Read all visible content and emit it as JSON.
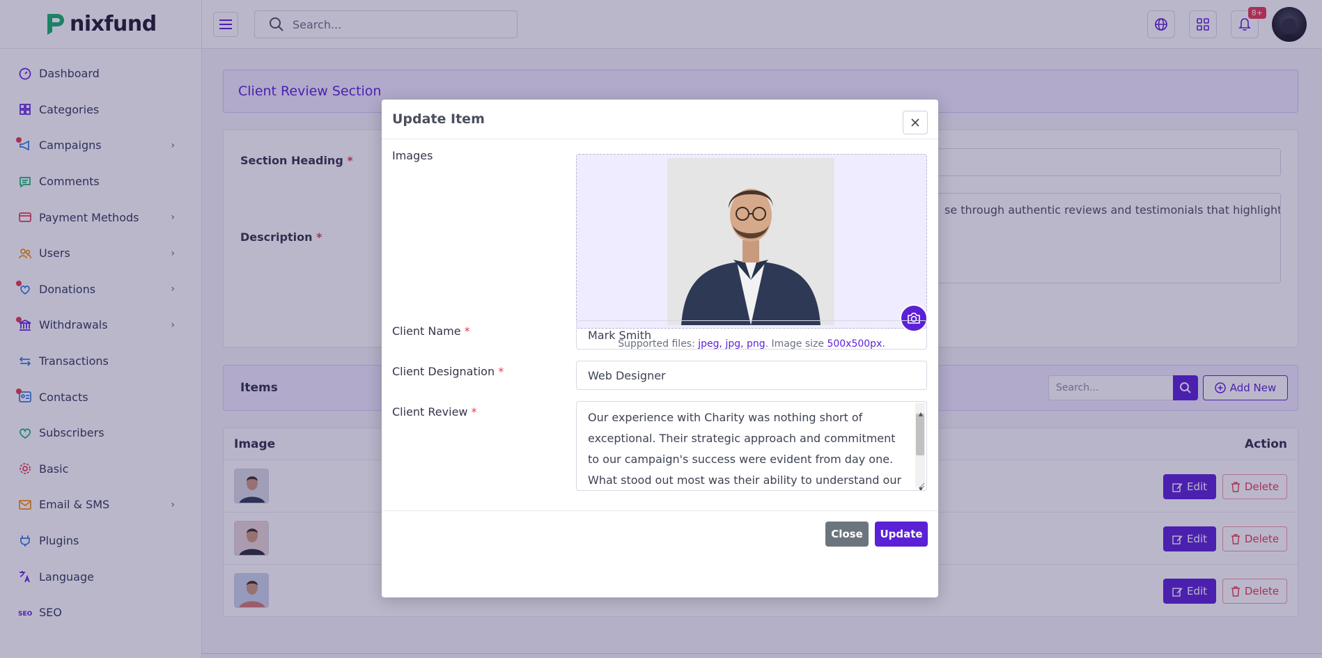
{
  "brand": {
    "name": "nixfund"
  },
  "sidebar": {
    "items": [
      {
        "label": "Dashboard",
        "icon": "dashboard-icon",
        "color": "#5b21d6",
        "dot": false,
        "chevron": false
      },
      {
        "label": "Categories",
        "icon": "grid-icon",
        "color": "#5b21d6",
        "dot": false,
        "chevron": false
      },
      {
        "label": "Campaigns",
        "icon": "megaphone-icon",
        "color": "#2c7be5",
        "dot": true,
        "chevron": true
      },
      {
        "label": "Comments",
        "icon": "comment-icon",
        "color": "#12b76a",
        "dot": false,
        "chevron": false
      },
      {
        "label": "Payment Methods",
        "icon": "credit-card-icon",
        "color": "#e53950",
        "dot": false,
        "chevron": true
      },
      {
        "label": "Users",
        "icon": "users-icon",
        "color": "#f79009",
        "dot": false,
        "chevron": true
      },
      {
        "label": "Donations",
        "icon": "donation-icon",
        "color": "#2c7be5",
        "dot": true,
        "chevron": true
      },
      {
        "label": "Withdrawals",
        "icon": "bank-icon",
        "color": "#5b21d6",
        "dot": true,
        "chevron": true
      },
      {
        "label": "Transactions",
        "icon": "transfer-icon",
        "color": "#2c7be5",
        "dot": false,
        "chevron": false
      },
      {
        "label": "Contacts",
        "icon": "contact-card-icon",
        "color": "#2c7be5",
        "dot": true,
        "chevron": false
      },
      {
        "label": "Subscribers",
        "icon": "heart-icon",
        "color": "#12b76a",
        "dot": false,
        "chevron": false
      },
      {
        "label": "Basic",
        "icon": "gear-icon",
        "color": "#e53950",
        "dot": false,
        "chevron": false
      },
      {
        "label": "Email & SMS",
        "icon": "mail-icon",
        "color": "#f79009",
        "dot": false,
        "chevron": true
      },
      {
        "label": "Plugins",
        "icon": "plug-icon",
        "color": "#2c7be5",
        "dot": false,
        "chevron": false
      },
      {
        "label": "Language",
        "icon": "translate-icon",
        "color": "#5b21d6",
        "dot": false,
        "chevron": false
      },
      {
        "label": "SEO",
        "icon": "seo-icon",
        "color": "#5b21d6",
        "dot": false,
        "chevron": false
      }
    ]
  },
  "topbar": {
    "search_placeholder": "Search...",
    "notification_count": "8+"
  },
  "page": {
    "section_title": "Client Review Section",
    "section_heading_label": "Section Heading",
    "description_label": "Description",
    "description_value": "se through authentic reviews and testimonials that highlight",
    "required_mark": "*"
  },
  "items": {
    "title": "Items",
    "search_placeholder": "Search...",
    "add_new_label": "Add New",
    "columns": {
      "image": "Image",
      "action": "Action"
    },
    "edit_label": "Edit",
    "delete_label": "Delete",
    "rows": [
      {
        "shirt": "#2e3a55",
        "bg": "#d9dce3"
      },
      {
        "shirt": "#2a2f3d",
        "bg": "#e6d7d4"
      },
      {
        "shirt": "#d27a74",
        "bg": "#c9d6ea"
      }
    ]
  },
  "modal": {
    "title": "Update Item",
    "images_label": "Images",
    "supported_prefix": "Supported files: ",
    "supported_types": "jpeg, jpg, png",
    "supported_mid": ". Image size ",
    "supported_size": "500x500px",
    "supported_suffix": ".",
    "client_name_label": "Client Name",
    "client_name_value": "Mark Smith",
    "client_designation_label": "Client Designation",
    "client_designation_value": "Web Designer",
    "client_review_label": "Client Review",
    "client_review_value": "Our experience with Charity was nothing short of exceptional. Their strategic approach and commitment to our campaign's success were evident from day one. What stood out most was their ability to understand our objectives",
    "close_label": "Close",
    "update_label": "Update"
  },
  "colors": {
    "accent": "#5b21d6",
    "danger": "#e53950",
    "muted_button": "#6c757d"
  }
}
